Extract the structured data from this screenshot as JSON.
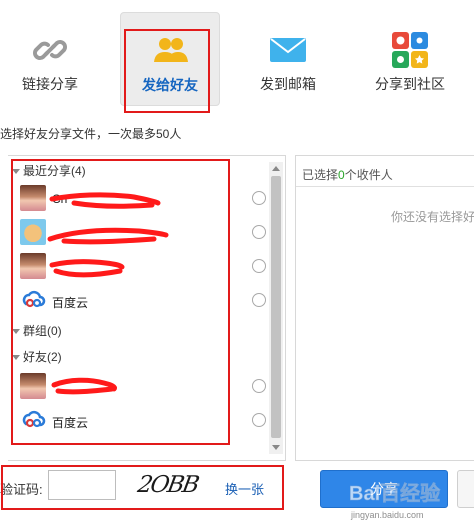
{
  "tabs": [
    {
      "label": "链接分享",
      "icon": "link-icon",
      "active": false
    },
    {
      "label": "发给好友",
      "icon": "friends-icon",
      "active": true
    },
    {
      "label": "发到邮箱",
      "icon": "mail-icon",
      "active": false
    },
    {
      "label": "分享到社区",
      "icon": "community-icon",
      "active": false
    }
  ],
  "hint": "选择好友分享文件，一次最多50人",
  "friend_list": {
    "groups": [
      {
        "title": "最近分享(4)"
      },
      {
        "title": "群组(0)"
      },
      {
        "title": "好友(2)"
      }
    ],
    "rows": [
      {
        "name": "Cn",
        "avatar": "avatar-girl"
      },
      {
        "name": "",
        "avatar": "avatar-bear"
      },
      {
        "name": "",
        "avatar": "avatar-girl"
      },
      {
        "name": "百度云",
        "avatar": "baidu-cloud-icon"
      },
      {
        "name": "",
        "avatar": "avatar-girl"
      },
      {
        "name": "百度云",
        "avatar": "baidu-cloud-icon"
      }
    ]
  },
  "recipients": {
    "prefix": "已选择",
    "count": "0",
    "suffix": "个收件人",
    "empty_text": "你还没有选择好"
  },
  "captcha": {
    "label": "验证码:",
    "value": "",
    "image_text": "2OBB",
    "refresh_label": "换一张"
  },
  "share_button_label": "分享",
  "watermark": {
    "text": "Bai百经验",
    "sub": "jingyan.baidu.com"
  },
  "colors": {
    "accent": "#2f86e8",
    "highlight_box": "#e21a1a",
    "active_tab_text": "#1565c0",
    "count": "#2aa52a"
  }
}
